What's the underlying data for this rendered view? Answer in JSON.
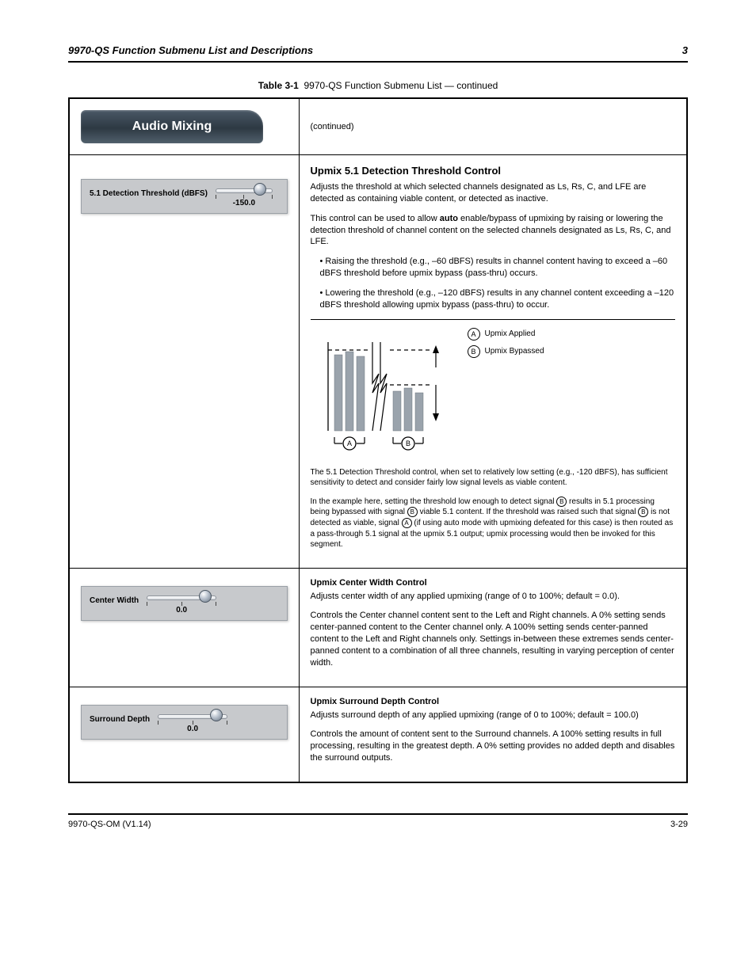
{
  "header": {
    "doc_id": "9970-QS",
    "title": "9970-QS Function Submenu List and Descriptions",
    "section_no": "3"
  },
  "table_caption": {
    "bold": "Table 3-1",
    "rest": "9970-QS Function Submenu List — continued"
  },
  "tab": {
    "label": "Audio Mixing"
  },
  "continued_note": "(continued)",
  "row1": {
    "panel_label": "5.1 Detection Threshold (dBFS)",
    "slider_value": "-150.0",
    "title": "Upmix 5.1 Detection Threshold Control",
    "p1": "Adjusts the threshold at which selected channels designated as Ls, Rs, C, and LFE are detected as containing viable content, or detected as inactive.",
    "p2_pre": "This control can be used to allow ",
    "p2_auto": "auto",
    "p2_post": " enable/bypass of upmixing by raising or lowering the detection threshold of channel content on the selected channels designated as Ls, Rs, C, and LFE.",
    "bullets": [
      "Raising the threshold (e.g., –60 dBFS) results in channel content having to exceed a –60 dBFS threshold before upmix bypass (pass-thru) occurs.",
      "Lowering the threshold (e.g., –120 dBFS) results in any channel content exceeding a –120 dBFS threshold allowing upmix bypass (pass-thru) to occur."
    ],
    "diagram": {
      "legend_a": "Upmix Applied",
      "legend_b": "Upmix Bypassed",
      "group_a": "A",
      "group_b": "B",
      "caption1": "The 5.1 Detection Threshold control, when set to relatively low setting (e.g., -120 dBFS), has sufficient sensitivity to detect and consider fairly low signal levels as viable content.",
      "caption2_pre": "In the example here, setting the threshold low enough to detect signal",
      "caption2_groupB": "B",
      "caption2_mid": "results in 5.1 processing being bypassed with signal",
      "caption2_groupBagain": "B",
      "caption2_mid2": "viable 5.1 content. If the threshold was raised such that signal",
      "caption2_groupBagain2": "B",
      "caption2_mid3": "is not detected as viable, signal",
      "caption2_groupA": "A",
      "caption2_end": "(if using auto mode with upmixing defeated for this case) is then routed as a pass-through 5.1 signal at the upmix 5.1 output; upmix processing would then be invoked for this segment."
    }
  },
  "row2": {
    "panel_label": "Center Width",
    "slider_value": "0.0",
    "title": "Upmix Center Width Control",
    "p1": "Adjusts center width of any applied upmixing (range of 0 to 100%; default = 0.0).",
    "p2": "Controls the Center channel content sent to the Left and Right channels. A 0% setting sends center-panned content to the Center channel only. A 100% setting sends center-panned content to the Left and Right channels only. Settings in-between these extremes sends center-panned content to a combination of all three channels, resulting in varying perception of center width."
  },
  "row3": {
    "panel_label": "Surround Depth",
    "slider_value": "0.0",
    "title": "Upmix Surround Depth Control",
    "p1": "Adjusts surround depth of any applied upmixing (range of 0 to 100%; default = 100.0)",
    "p2": "Controls the amount of content sent to the Surround channels. A 100% setting results in full processing, resulting in the greatest depth. A 0% setting provides no added depth and disables the surround outputs."
  },
  "footer": {
    "left": "9970-QS-OM (V1.14)",
    "right": "3-29"
  }
}
